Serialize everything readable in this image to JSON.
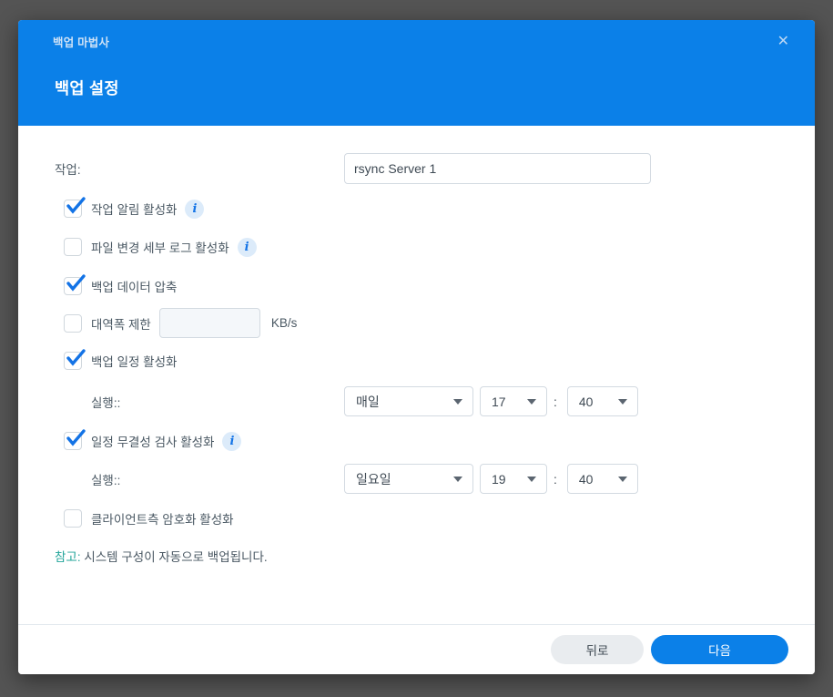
{
  "window": {
    "title": "백업 마법사"
  },
  "icons": {
    "close": "✕",
    "info": "i",
    "colon": ":"
  },
  "header": {
    "title": "백업 설정"
  },
  "form": {
    "task": {
      "label": "작업:",
      "value": "rsync Server 1"
    },
    "notify": {
      "label": "작업 알림 활성화",
      "checked": true
    },
    "filelog": {
      "label": "파일 변경 세부 로그 활성화",
      "checked": false
    },
    "compress": {
      "label": "백업 데이터 압축",
      "checked": true
    },
    "bandwidth": {
      "label": "대역폭 제한",
      "checked": false,
      "value": "",
      "unit": "KB/s"
    },
    "schedule": {
      "label": "백업 일정 활성화",
      "checked": true,
      "run_label": "실행::",
      "frequency": "매일",
      "hour": "17",
      "minute": "40"
    },
    "integrity": {
      "label": "일정 무결성 검사 활성화",
      "checked": true,
      "run_label": "실행::",
      "frequency": "일요일",
      "hour": "19",
      "minute": "40"
    },
    "encryption": {
      "label": "클라이언트측 암호화 활성화",
      "checked": false
    },
    "note": {
      "prefix": "참고:",
      "text": " 시스템 구성이 자동으로 백업됩니다."
    }
  },
  "footer": {
    "back": "뒤로",
    "next": "다음"
  },
  "colors": {
    "accent": "#0b80e8",
    "note": "#23a59a"
  }
}
